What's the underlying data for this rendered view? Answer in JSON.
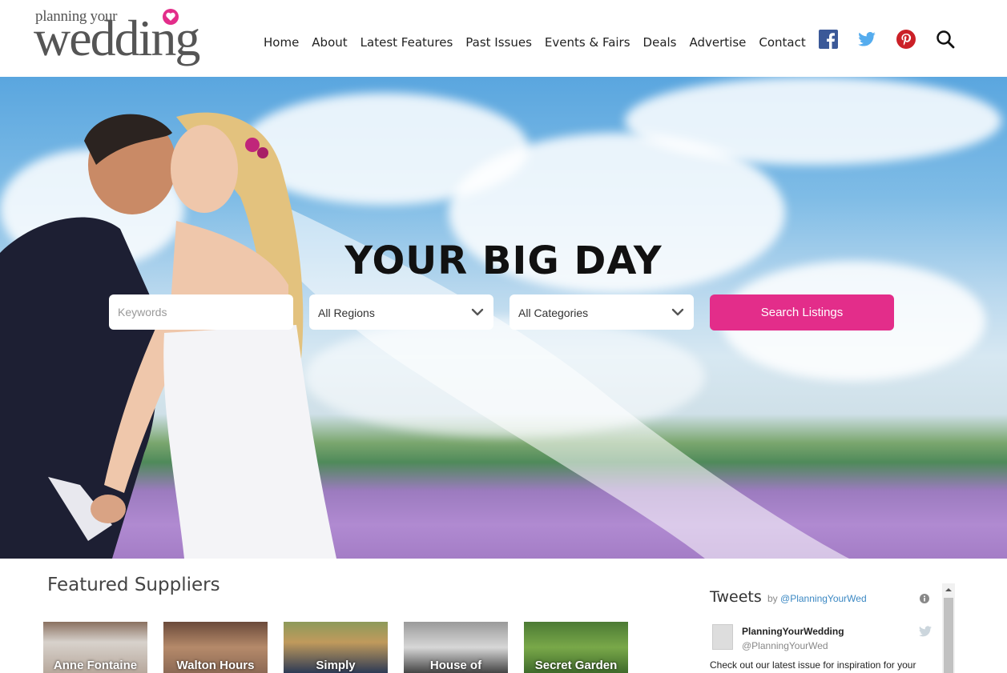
{
  "logo": {
    "small_text": "planning your",
    "big_text": "wedding"
  },
  "nav": {
    "items": [
      "Home",
      "About",
      "Latest Features",
      "Past Issues",
      "Events & Fairs",
      "Deals",
      "Advertise",
      "Contact"
    ]
  },
  "social_icons": [
    "facebook-icon",
    "twitter-icon",
    "pinterest-icon",
    "search-icon"
  ],
  "colors": {
    "accent": "#e32d8a",
    "facebook": "#3b5998",
    "twitter": "#55acee",
    "pinterest": "#cb2027"
  },
  "hero": {
    "title": "YOUR BIG DAY",
    "keywords_placeholder": "Keywords",
    "region_value": "All Regions",
    "category_value": "All Categories",
    "search_button": "Search Listings"
  },
  "featured": {
    "title": "Featured Suppliers",
    "suppliers": [
      "Anne Fontaine",
      "Walton Hours",
      "Simply",
      "House of",
      "Secret Garden"
    ]
  },
  "tweets": {
    "heading": "Tweets",
    "by_prefix": "by",
    "by_handle": "@PlanningYourWed",
    "author_name": "PlanningYourWedding",
    "author_handle": "@PlanningYourWed",
    "text": "Check out our latest issue for inspiration for your"
  }
}
